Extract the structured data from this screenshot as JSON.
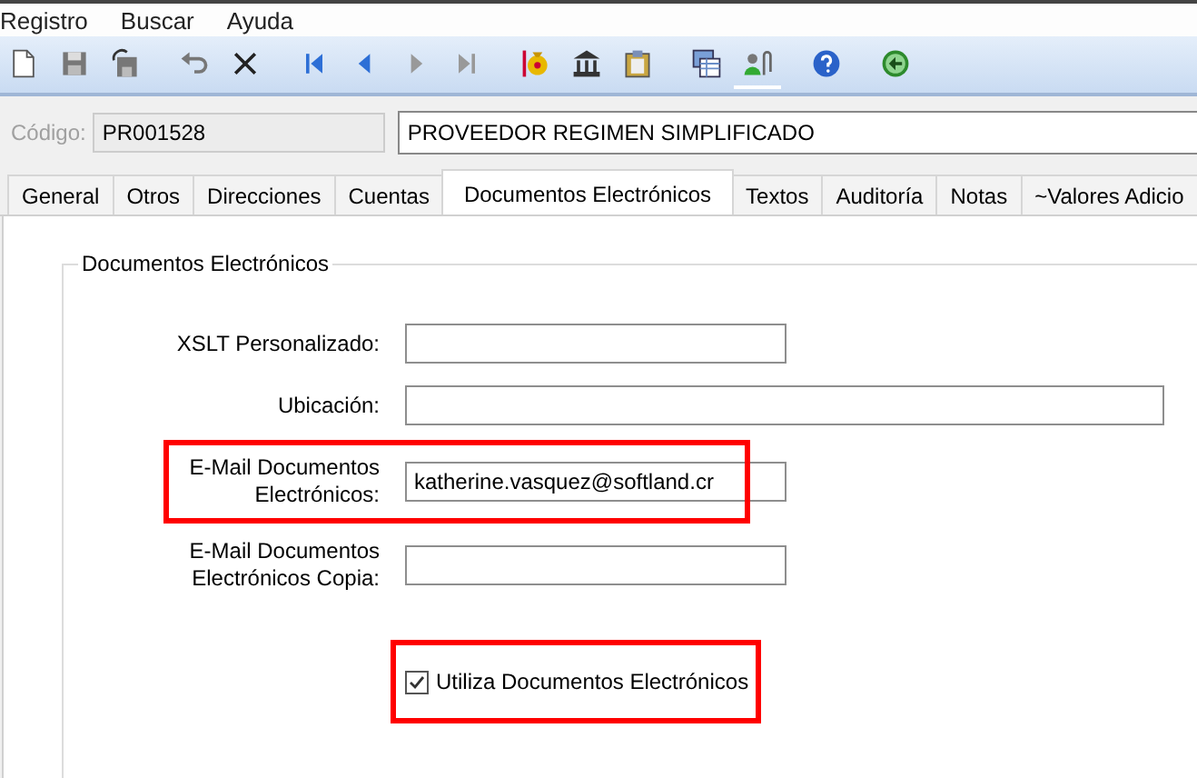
{
  "menu": [
    "Registro",
    "Buscar",
    "Ayuda"
  ],
  "toolbar_groups": [
    [
      {
        "kind": "new",
        "selected": false
      },
      {
        "kind": "save",
        "selected": false
      },
      {
        "kind": "save-as",
        "selected": false
      }
    ],
    [
      {
        "kind": "undo",
        "selected": false
      },
      {
        "kind": "delete",
        "selected": false
      }
    ],
    [
      {
        "kind": "first",
        "selected": false
      },
      {
        "kind": "prev",
        "selected": false
      },
      {
        "kind": "next",
        "selected": false
      },
      {
        "kind": "last",
        "selected": false
      }
    ],
    [
      {
        "kind": "money",
        "selected": false
      },
      {
        "kind": "bank",
        "selected": false
      },
      {
        "kind": "clipboard",
        "selected": false
      }
    ],
    [
      {
        "kind": "windows",
        "selected": false
      },
      {
        "kind": "user-clip",
        "selected": true
      }
    ],
    [
      {
        "kind": "help",
        "selected": false
      }
    ],
    [
      {
        "kind": "back",
        "selected": false
      }
    ]
  ],
  "record": {
    "code_label": "Código:",
    "code_disabled": true,
    "code": "PR001528",
    "name": "PROVEEDOR REGIMEN SIMPLIFICADO"
  },
  "tabs": [
    {
      "label": "General",
      "selected": false
    },
    {
      "label": "Otros",
      "selected": false
    },
    {
      "label": "Direcciones",
      "selected": false
    },
    {
      "label": "Cuentas",
      "selected": false
    },
    {
      "label": "Documentos Electrónicos",
      "selected": true
    },
    {
      "label": "Textos",
      "selected": false
    },
    {
      "label": "Auditoría",
      "selected": false
    },
    {
      "label": "Notas",
      "selected": false
    },
    {
      "label": "~Valores Adicio",
      "selected": false
    }
  ],
  "group": {
    "title": "Documentos Electrónicos",
    "fields": [
      {
        "label": "XSLT Personalizado:",
        "kind": "short",
        "highlighted": false
      },
      {
        "label": "Ubicación:",
        "kind": "long",
        "highlighted": false
      },
      {
        "label": "E-Mail Documentos Electrónicos:",
        "kind": "short",
        "value": "katherine.vasquez@softland.cr",
        "highlighted": true
      },
      {
        "label": "E-Mail Documentos Electrónicos Copia:",
        "kind": "short",
        "highlighted": false
      }
    ],
    "checkbox": {
      "label": "Utiliza Documentos Electrónicos",
      "checked": true,
      "highlighted": true
    }
  }
}
